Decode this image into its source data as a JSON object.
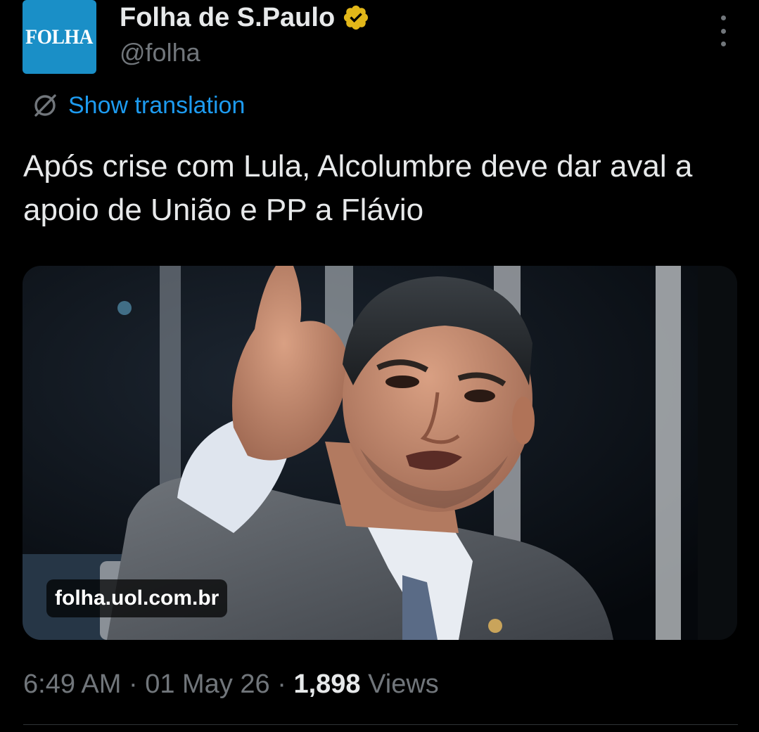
{
  "author": {
    "avatar_text": "FOLHA",
    "display_name": "Folha de S.Paulo",
    "handle": "@folha",
    "verified_badge": "gold-verified-badge-icon",
    "avatar_color": "#1a8fc7"
  },
  "menu": {
    "icon": "more-vertical-icon"
  },
  "translation": {
    "label": "Show translation",
    "icon": "translate-icon",
    "color": "#1d9bf0"
  },
  "tweet": {
    "text": "Após crise com Lula, Alcolumbre deve dar aval a apoio de União e PP a Flávio"
  },
  "card": {
    "domain": "folha.uol.com.br",
    "image": "photo of a man in a grey suit gesturing with his raised hand"
  },
  "meta": {
    "time": "6:49 AM",
    "separator": "·",
    "date": "01 May 26",
    "views_count": "1,898",
    "views_label": "Views"
  },
  "colors": {
    "background": "#000000",
    "text_primary": "#e7e9ea",
    "text_secondary": "#71767b",
    "link": "#1d9bf0",
    "verified_gold": "#e2b719"
  }
}
